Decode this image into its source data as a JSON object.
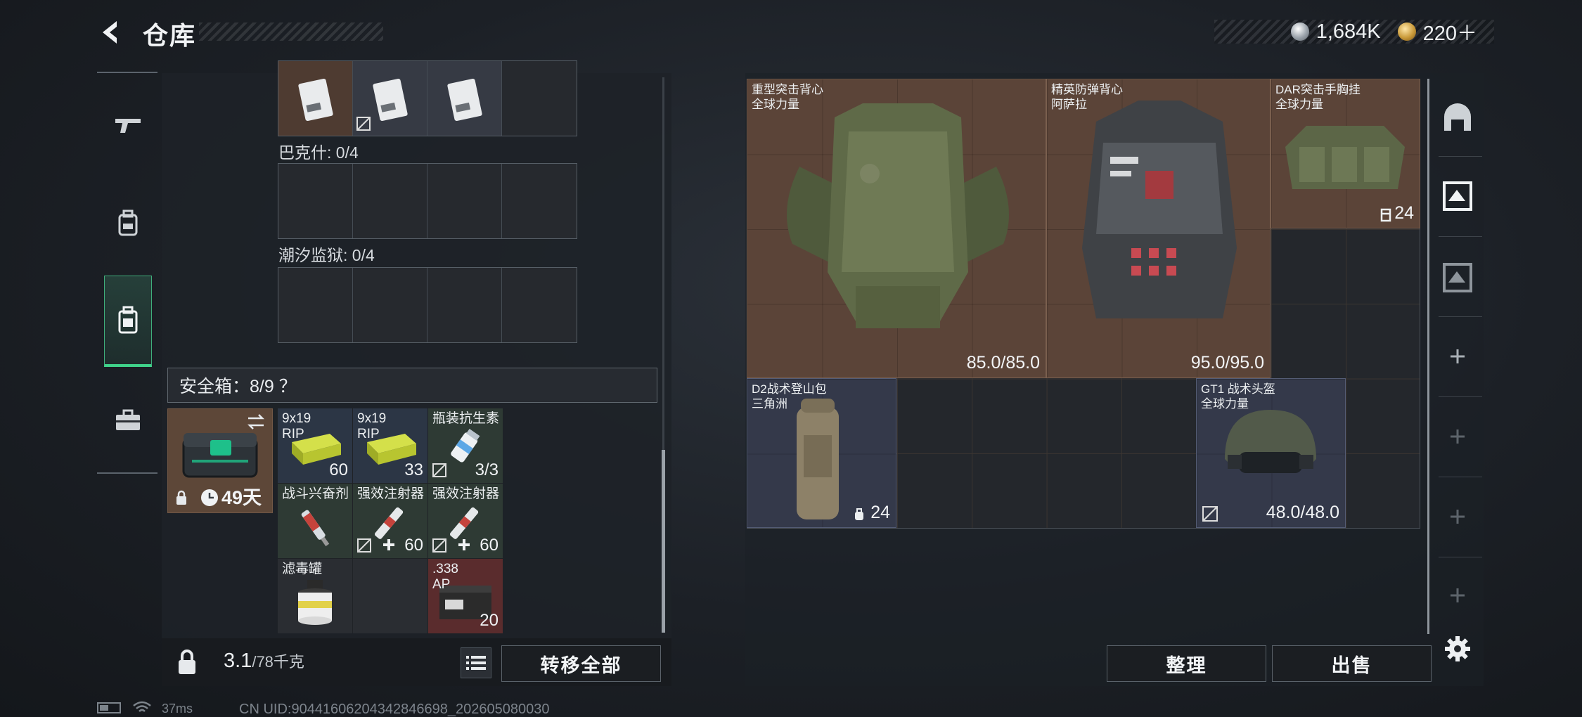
{
  "header": {
    "title": "仓库",
    "currency": [
      {
        "icon": "silver-coin-icon",
        "value": "1,684K"
      },
      {
        "icon": "gold-coin-icon",
        "value": "220＋"
      }
    ]
  },
  "left_nav": [
    "gun-icon",
    "backpack-icon",
    "container-icon",
    "briefcase-icon"
  ],
  "containers": {
    "top_row_items": [
      "card-icon",
      "card-icon",
      "card-icon"
    ],
    "groups": [
      {
        "label": "巴克什: 0/4"
      },
      {
        "label": "潮汐监狱: 0/4"
      }
    ]
  },
  "safebox": {
    "header": "安全箱：8/9 ？",
    "remaining": "49天",
    "items": [
      {
        "name": "9x19\nRIP",
        "count": "60",
        "color": "green"
      },
      {
        "name": "9x19\nRIP",
        "count": "33",
        "color": "green"
      },
      {
        "name": "瓶装抗生素",
        "count": "3/3",
        "color": "green"
      },
      {
        "name": "战斗兴奋剂",
        "count": "",
        "color": "green"
      },
      {
        "name": "强效注射器",
        "count": "60",
        "color": "green"
      },
      {
        "name": "强效注射器",
        "count": "60",
        "color": "green"
      },
      {
        "name": "滤毒罐",
        "count": "",
        "color": "dark"
      },
      {
        "name": "",
        "count": "",
        "color": "dark"
      },
      {
        "name": ".338\nAP",
        "count": "20",
        "color": "red"
      }
    ]
  },
  "bottom": {
    "weight": "3.1",
    "weight_max": "/78千克",
    "transfer_all": "转移全部"
  },
  "gear": [
    {
      "name": "重型突击背心\n全球力量",
      "value": "85.0/85.0"
    },
    {
      "name": "精英防弹背心\n阿萨拉",
      "value": "95.0/95.0"
    },
    {
      "name": "DAR突击手胸挂\n全球力量",
      "value": "24"
    },
    {
      "name": "D2战术登山包\n三角洲",
      "value": "24"
    },
    {
      "name": "GT1 战术头盔\n全球力量",
      "value": "48.0/48.0"
    }
  ],
  "actions": {
    "organize": "整理",
    "sell": "出售"
  },
  "status": {
    "ping": "37ms",
    "uid": "CN UID:904416062043428466​98_202605080030"
  }
}
